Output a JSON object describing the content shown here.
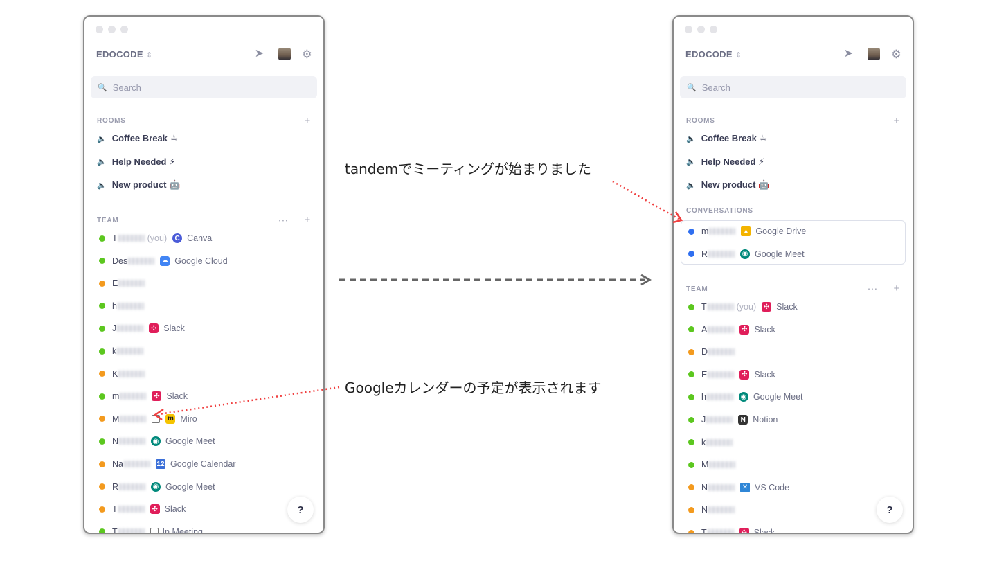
{
  "annotations": {
    "meeting": "tandemでミーティングが始まりました",
    "calendar": "Googleカレンダーの予定が表示されます"
  },
  "left": {
    "workspace": "EDOCODE",
    "search_placeholder": "Search",
    "rooms_label": "ROOMS",
    "team_label": "TEAM",
    "help": "?",
    "rooms": [
      {
        "label": "Coffee Break ☕"
      },
      {
        "label": "Help Needed ⚡"
      },
      {
        "label": "New product 🤖"
      }
    ],
    "team": [
      {
        "name": "T",
        "you": "(you)",
        "status": "green",
        "app": "Canva",
        "icon": "canva"
      },
      {
        "name": "Des",
        "status": "green",
        "app": "Google Cloud",
        "icon": "gcloud"
      },
      {
        "name": "E",
        "status": "orange",
        "app": "",
        "icon": ""
      },
      {
        "name": "h",
        "status": "green",
        "app": "",
        "icon": ""
      },
      {
        "name": "J",
        "status": "green",
        "app": "Slack",
        "icon": "slack"
      },
      {
        "name": "k",
        "status": "green",
        "app": "",
        "icon": ""
      },
      {
        "name": "K",
        "status": "orange",
        "app": "",
        "icon": ""
      },
      {
        "name": "m",
        "status": "green",
        "app": "Slack",
        "icon": "slack"
      },
      {
        "name": "M",
        "status": "orange",
        "app": "Miro",
        "icon": "miro",
        "calendar": true
      },
      {
        "name": "N",
        "status": "green",
        "app": "Google Meet",
        "icon": "meet"
      },
      {
        "name": "Na",
        "status": "orange",
        "app": "Google Calendar",
        "icon": "gcal"
      },
      {
        "name": "R",
        "status": "orange",
        "app": "Google Meet",
        "icon": "meet"
      },
      {
        "name": "T",
        "status": "orange",
        "app": "Slack",
        "icon": "slack"
      },
      {
        "name": "T",
        "status": "green",
        "app": "In Meeting",
        "icon": "",
        "calendar": true
      }
    ]
  },
  "right": {
    "workspace": "EDOCODE",
    "search_placeholder": "Search",
    "rooms_label": "ROOMS",
    "conversations_label": "CONVERSATIONS",
    "team_label": "TEAM",
    "help": "?",
    "rooms": [
      {
        "label": "Coffee Break ☕"
      },
      {
        "label": "Help Needed ⚡"
      },
      {
        "label": "New product 🤖"
      }
    ],
    "conversations": [
      {
        "name": "m",
        "status": "blue",
        "app": "Google Drive",
        "icon": "gdrive"
      },
      {
        "name": "R",
        "status": "blue",
        "app": "Google Meet",
        "icon": "meet"
      }
    ],
    "team": [
      {
        "name": "T",
        "you": "(you)",
        "status": "green",
        "app": "Slack",
        "icon": "slack"
      },
      {
        "name": "A",
        "status": "green",
        "app": "Slack",
        "icon": "slack"
      },
      {
        "name": "D",
        "status": "orange",
        "app": "",
        "icon": ""
      },
      {
        "name": "E",
        "status": "green",
        "app": "Slack",
        "icon": "slack"
      },
      {
        "name": "h",
        "status": "green",
        "app": "Google Meet",
        "icon": "meet"
      },
      {
        "name": "J",
        "status": "green",
        "app": "Notion",
        "icon": "notion"
      },
      {
        "name": "k",
        "status": "green",
        "app": "",
        "icon": ""
      },
      {
        "name": "M",
        "status": "green",
        "app": "",
        "icon": ""
      },
      {
        "name": "N",
        "status": "orange",
        "app": "VS Code",
        "icon": "vscode"
      },
      {
        "name": "N",
        "status": "orange",
        "app": "",
        "icon": ""
      },
      {
        "name": "T",
        "status": "orange",
        "app": "Slack",
        "icon": "slack"
      }
    ]
  },
  "colors": {
    "green": "#5cc71f",
    "orange": "#f39a1e",
    "blue": "#2f6ff0",
    "arrow": "#f04040",
    "dash": "#666666"
  }
}
